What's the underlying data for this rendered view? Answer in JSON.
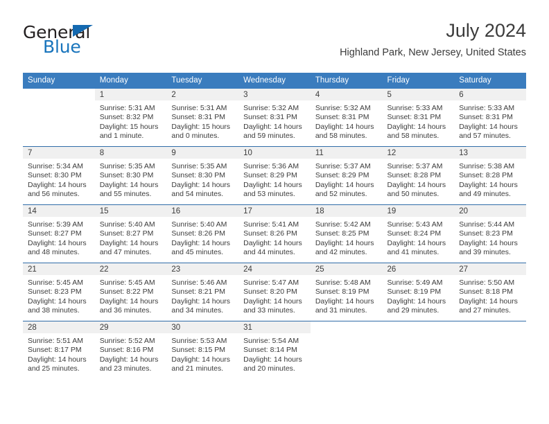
{
  "brand": {
    "name_part1": "General",
    "name_part2": "Blue",
    "triangle_color": "#1469b0",
    "blue_color": "#1874bc"
  },
  "header": {
    "title": "July 2024",
    "subtitle": "Highland Park, New Jersey, United States"
  },
  "theme": {
    "header_bg": "#3a7cbe",
    "header_text": "#ffffff",
    "daynum_band_bg": "#f0f0f0",
    "row_divider": "#2f6ca8",
    "body_text": "#3b3b3b"
  },
  "calendar": {
    "weekday_headers": [
      "Sunday",
      "Monday",
      "Tuesday",
      "Wednesday",
      "Thursday",
      "Friday",
      "Saturday"
    ],
    "weeks": [
      [
        {
          "day": "",
          "sunrise": "",
          "sunset": "",
          "daylight_line1": "",
          "daylight_line2": "",
          "empty": true
        },
        {
          "day": "1",
          "sunrise": "Sunrise: 5:31 AM",
          "sunset": "Sunset: 8:32 PM",
          "daylight_line1": "Daylight: 15 hours",
          "daylight_line2": "and 1 minute."
        },
        {
          "day": "2",
          "sunrise": "Sunrise: 5:31 AM",
          "sunset": "Sunset: 8:31 PM",
          "daylight_line1": "Daylight: 15 hours",
          "daylight_line2": "and 0 minutes."
        },
        {
          "day": "3",
          "sunrise": "Sunrise: 5:32 AM",
          "sunset": "Sunset: 8:31 PM",
          "daylight_line1": "Daylight: 14 hours",
          "daylight_line2": "and 59 minutes."
        },
        {
          "day": "4",
          "sunrise": "Sunrise: 5:32 AM",
          "sunset": "Sunset: 8:31 PM",
          "daylight_line1": "Daylight: 14 hours",
          "daylight_line2": "and 58 minutes."
        },
        {
          "day": "5",
          "sunrise": "Sunrise: 5:33 AM",
          "sunset": "Sunset: 8:31 PM",
          "daylight_line1": "Daylight: 14 hours",
          "daylight_line2": "and 58 minutes."
        },
        {
          "day": "6",
          "sunrise": "Sunrise: 5:33 AM",
          "sunset": "Sunset: 8:31 PM",
          "daylight_line1": "Daylight: 14 hours",
          "daylight_line2": "and 57 minutes."
        }
      ],
      [
        {
          "day": "7",
          "sunrise": "Sunrise: 5:34 AM",
          "sunset": "Sunset: 8:30 PM",
          "daylight_line1": "Daylight: 14 hours",
          "daylight_line2": "and 56 minutes."
        },
        {
          "day": "8",
          "sunrise": "Sunrise: 5:35 AM",
          "sunset": "Sunset: 8:30 PM",
          "daylight_line1": "Daylight: 14 hours",
          "daylight_line2": "and 55 minutes."
        },
        {
          "day": "9",
          "sunrise": "Sunrise: 5:35 AM",
          "sunset": "Sunset: 8:30 PM",
          "daylight_line1": "Daylight: 14 hours",
          "daylight_line2": "and 54 minutes."
        },
        {
          "day": "10",
          "sunrise": "Sunrise: 5:36 AM",
          "sunset": "Sunset: 8:29 PM",
          "daylight_line1": "Daylight: 14 hours",
          "daylight_line2": "and 53 minutes."
        },
        {
          "day": "11",
          "sunrise": "Sunrise: 5:37 AM",
          "sunset": "Sunset: 8:29 PM",
          "daylight_line1": "Daylight: 14 hours",
          "daylight_line2": "and 52 minutes."
        },
        {
          "day": "12",
          "sunrise": "Sunrise: 5:37 AM",
          "sunset": "Sunset: 8:28 PM",
          "daylight_line1": "Daylight: 14 hours",
          "daylight_line2": "and 50 minutes."
        },
        {
          "day": "13",
          "sunrise": "Sunrise: 5:38 AM",
          "sunset": "Sunset: 8:28 PM",
          "daylight_line1": "Daylight: 14 hours",
          "daylight_line2": "and 49 minutes."
        }
      ],
      [
        {
          "day": "14",
          "sunrise": "Sunrise: 5:39 AM",
          "sunset": "Sunset: 8:27 PM",
          "daylight_line1": "Daylight: 14 hours",
          "daylight_line2": "and 48 minutes."
        },
        {
          "day": "15",
          "sunrise": "Sunrise: 5:40 AM",
          "sunset": "Sunset: 8:27 PM",
          "daylight_line1": "Daylight: 14 hours",
          "daylight_line2": "and 47 minutes."
        },
        {
          "day": "16",
          "sunrise": "Sunrise: 5:40 AM",
          "sunset": "Sunset: 8:26 PM",
          "daylight_line1": "Daylight: 14 hours",
          "daylight_line2": "and 45 minutes."
        },
        {
          "day": "17",
          "sunrise": "Sunrise: 5:41 AM",
          "sunset": "Sunset: 8:26 PM",
          "daylight_line1": "Daylight: 14 hours",
          "daylight_line2": "and 44 minutes."
        },
        {
          "day": "18",
          "sunrise": "Sunrise: 5:42 AM",
          "sunset": "Sunset: 8:25 PM",
          "daylight_line1": "Daylight: 14 hours",
          "daylight_line2": "and 42 minutes."
        },
        {
          "day": "19",
          "sunrise": "Sunrise: 5:43 AM",
          "sunset": "Sunset: 8:24 PM",
          "daylight_line1": "Daylight: 14 hours",
          "daylight_line2": "and 41 minutes."
        },
        {
          "day": "20",
          "sunrise": "Sunrise: 5:44 AM",
          "sunset": "Sunset: 8:23 PM",
          "daylight_line1": "Daylight: 14 hours",
          "daylight_line2": "and 39 minutes."
        }
      ],
      [
        {
          "day": "21",
          "sunrise": "Sunrise: 5:45 AM",
          "sunset": "Sunset: 8:23 PM",
          "daylight_line1": "Daylight: 14 hours",
          "daylight_line2": "and 38 minutes."
        },
        {
          "day": "22",
          "sunrise": "Sunrise: 5:45 AM",
          "sunset": "Sunset: 8:22 PM",
          "daylight_line1": "Daylight: 14 hours",
          "daylight_line2": "and 36 minutes."
        },
        {
          "day": "23",
          "sunrise": "Sunrise: 5:46 AM",
          "sunset": "Sunset: 8:21 PM",
          "daylight_line1": "Daylight: 14 hours",
          "daylight_line2": "and 34 minutes."
        },
        {
          "day": "24",
          "sunrise": "Sunrise: 5:47 AM",
          "sunset": "Sunset: 8:20 PM",
          "daylight_line1": "Daylight: 14 hours",
          "daylight_line2": "and 33 minutes."
        },
        {
          "day": "25",
          "sunrise": "Sunrise: 5:48 AM",
          "sunset": "Sunset: 8:19 PM",
          "daylight_line1": "Daylight: 14 hours",
          "daylight_line2": "and 31 minutes."
        },
        {
          "day": "26",
          "sunrise": "Sunrise: 5:49 AM",
          "sunset": "Sunset: 8:19 PM",
          "daylight_line1": "Daylight: 14 hours",
          "daylight_line2": "and 29 minutes."
        },
        {
          "day": "27",
          "sunrise": "Sunrise: 5:50 AM",
          "sunset": "Sunset: 8:18 PM",
          "daylight_line1": "Daylight: 14 hours",
          "daylight_line2": "and 27 minutes."
        }
      ],
      [
        {
          "day": "28",
          "sunrise": "Sunrise: 5:51 AM",
          "sunset": "Sunset: 8:17 PM",
          "daylight_line1": "Daylight: 14 hours",
          "daylight_line2": "and 25 minutes."
        },
        {
          "day": "29",
          "sunrise": "Sunrise: 5:52 AM",
          "sunset": "Sunset: 8:16 PM",
          "daylight_line1": "Daylight: 14 hours",
          "daylight_line2": "and 23 minutes."
        },
        {
          "day": "30",
          "sunrise": "Sunrise: 5:53 AM",
          "sunset": "Sunset: 8:15 PM",
          "daylight_line1": "Daylight: 14 hours",
          "daylight_line2": "and 21 minutes."
        },
        {
          "day": "31",
          "sunrise": "Sunrise: 5:54 AM",
          "sunset": "Sunset: 8:14 PM",
          "daylight_line1": "Daylight: 14 hours",
          "daylight_line2": "and 20 minutes."
        },
        {
          "day": "",
          "sunrise": "",
          "sunset": "",
          "daylight_line1": "",
          "daylight_line2": "",
          "empty": true
        },
        {
          "day": "",
          "sunrise": "",
          "sunset": "",
          "daylight_line1": "",
          "daylight_line2": "",
          "empty": true
        },
        {
          "day": "",
          "sunrise": "",
          "sunset": "",
          "daylight_line1": "",
          "daylight_line2": "",
          "empty": true
        }
      ]
    ]
  }
}
